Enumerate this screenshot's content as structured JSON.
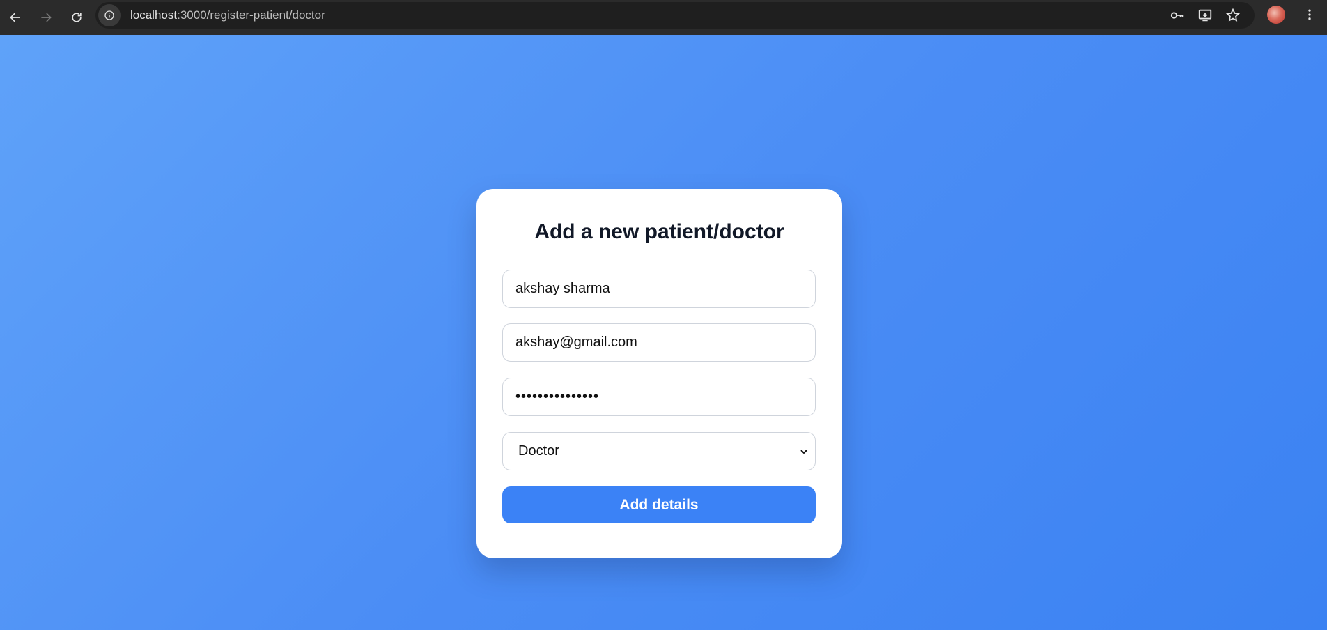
{
  "browser": {
    "url_host": "localhost",
    "url_rest": ":3000/register-patient/doctor"
  },
  "form": {
    "title": "Add a new patient/doctor",
    "name_value": "akshay sharma",
    "email_value": "akshay@gmail.com",
    "password_mask": "•••••••••••••••",
    "role_selected": "Doctor",
    "submit_label": "Add details"
  },
  "colors": {
    "accent": "#3b82f6",
    "background_gradient_start": "#5fa2f9",
    "background_gradient_end": "#3b82f2"
  }
}
